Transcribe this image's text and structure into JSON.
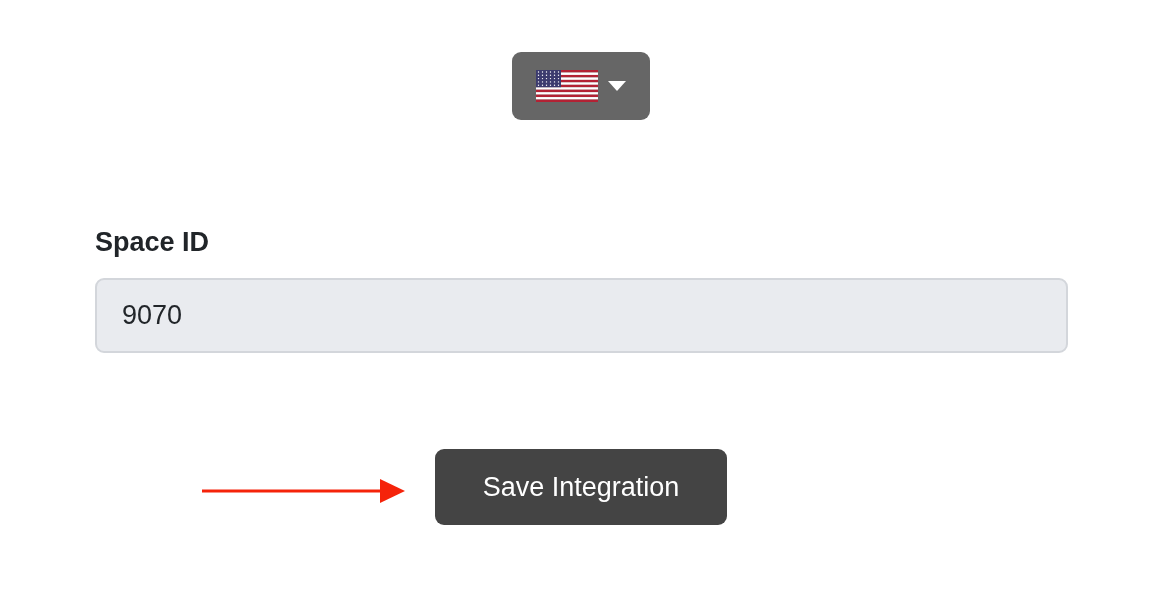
{
  "field": {
    "label": "Space ID",
    "value": "9070",
    "disabled": true
  },
  "save_button": {
    "label": "Save Integration"
  }
}
